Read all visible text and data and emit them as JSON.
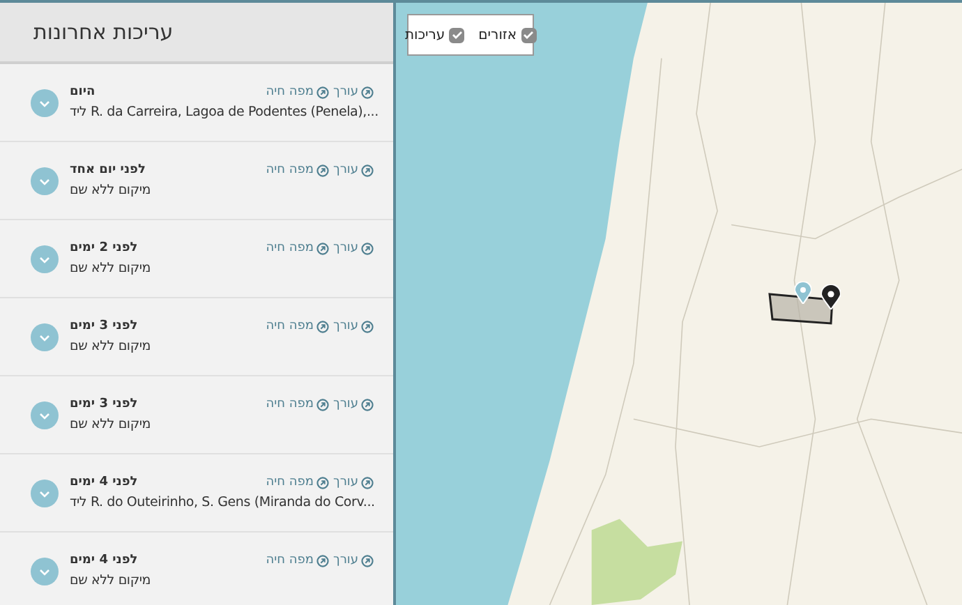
{
  "sidebar": {
    "title": "עריכות אחרונות",
    "items": [
      {
        "date": "היום",
        "location": "ליד R. da Carreira, Lagoa de Podentes (Penela),...",
        "links": [
          "עורך",
          "מפה חיה"
        ]
      },
      {
        "date": "לפני יום אחד",
        "location": "מיקום ללא שם",
        "links": [
          "עורך",
          "מפה חיה"
        ]
      },
      {
        "date": "לפני 2 ימים",
        "location": "מיקום ללא שם",
        "links": [
          "עורך",
          "מפה חיה"
        ]
      },
      {
        "date": "לפני 3 ימים",
        "location": "מיקום ללא שם",
        "links": [
          "עורך",
          "מפה חיה"
        ]
      },
      {
        "date": "לפני 3 ימים",
        "location": "מיקום ללא שם",
        "links": [
          "עורך",
          "מפה חיה"
        ]
      },
      {
        "date": "לפני 4 ימים",
        "location": "ליד R. do Outeirinho, S. Gens (Miranda do Corv...",
        "links": [
          "עורך",
          "מפה חיה"
        ]
      },
      {
        "date": "לפני 4 ימים",
        "location": "מיקום ללא שם",
        "links": [
          "עורך",
          "מפה חיה"
        ]
      }
    ]
  },
  "map": {
    "layers": [
      {
        "label": "אזורים",
        "checked": true
      },
      {
        "label": "עריכות",
        "checked": true
      }
    ]
  }
}
